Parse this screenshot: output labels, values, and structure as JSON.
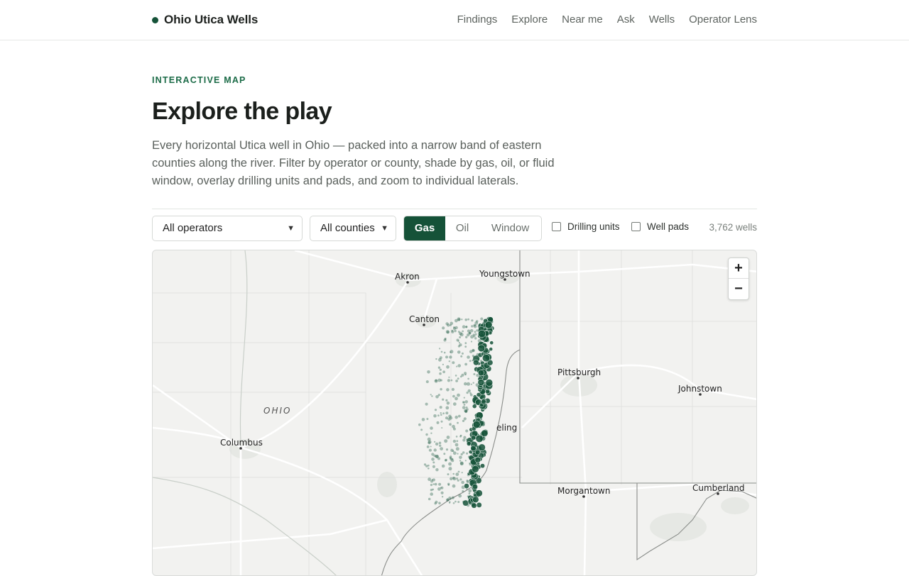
{
  "site": {
    "name": "Ohio Utica Wells",
    "accent": "#155238"
  },
  "nav": [
    "Findings",
    "Explore",
    "Near me",
    "Ask",
    "Wells",
    "Operator Lens"
  ],
  "hero": {
    "eyebrow": "INTERACTIVE MAP",
    "title": "Explore the play",
    "lede": "Every horizontal Utica well in Ohio — packed into a narrow band of eastern counties along the river. Filter by operator or county, shade by gas, oil, or fluid window, overlay drilling units and pads, and zoom to individual laterals."
  },
  "filters": {
    "operator": "All operators",
    "county": "All counties",
    "shade_options": [
      "Gas",
      "Oil",
      "Window"
    ],
    "shade_selected": "Gas",
    "drilling_units_label": "Drilling units",
    "drilling_units_checked": false,
    "well_pads_label": "Well pads",
    "well_pads_checked": false,
    "well_count": "3,762 wells"
  },
  "map": {
    "labels": {
      "akron": "Akron",
      "youngstown": "Youngstown",
      "canton": "Canton",
      "pittsburgh": "Pittsburgh",
      "johnstown": "Johnstown",
      "ohio": "OHIO",
      "columbus": "Columbus",
      "wheeling": "eling",
      "morgantown": "Morgantown",
      "cumberland": "Cumberland"
    },
    "zoom_in": "+",
    "zoom_out": "−",
    "well_color": "#155238"
  }
}
